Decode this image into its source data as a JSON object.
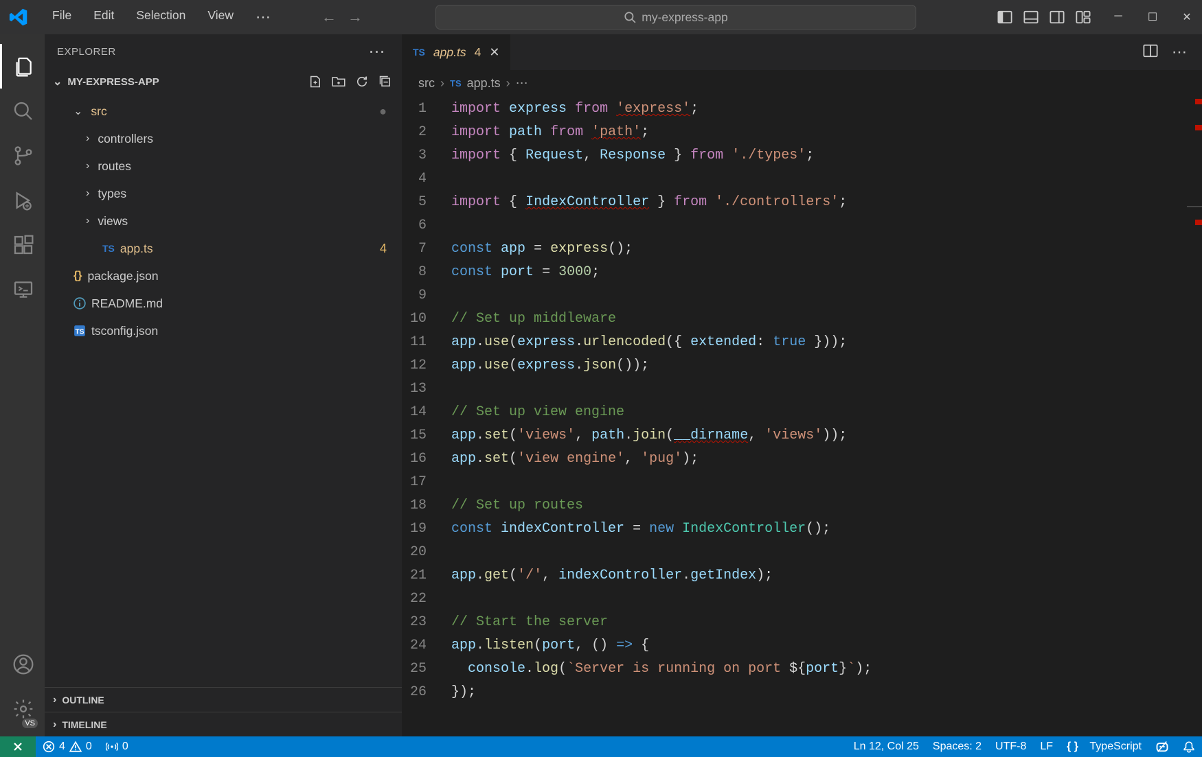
{
  "menubar": {
    "file": "File",
    "edit": "Edit",
    "selection": "Selection",
    "view": "View"
  },
  "search": {
    "placeholder": "my-express-app"
  },
  "explorer": {
    "title": "EXPLORER",
    "project": "MY-EXPRESS-APP",
    "tree": {
      "src": "src",
      "controllers": "controllers",
      "routes": "routes",
      "types": "types",
      "views": "views",
      "appts": "app.ts",
      "appts_marker": "4",
      "package": "package.json",
      "readme": "README.md",
      "tsconfig": "tsconfig.json"
    },
    "outline": "OUTLINE",
    "timeline": "TIMELINE"
  },
  "tab": {
    "fname": "app.ts",
    "errcount": "4"
  },
  "breadcrumb": {
    "p1": "src",
    "p2": "app.ts"
  },
  "code": {
    "lines": [
      1,
      2,
      3,
      4,
      5,
      6,
      7,
      8,
      9,
      10,
      11,
      12,
      13,
      14,
      15,
      16,
      17,
      18,
      19,
      20,
      21,
      22,
      23,
      24,
      25,
      26
    ]
  },
  "statusbar": {
    "errors": "4",
    "warnings": "0",
    "ports": "0",
    "ln_col": "Ln 12, Col 25",
    "spaces": "Spaces: 2",
    "encoding": "UTF-8",
    "eol": "LF",
    "language": "TypeScript"
  }
}
